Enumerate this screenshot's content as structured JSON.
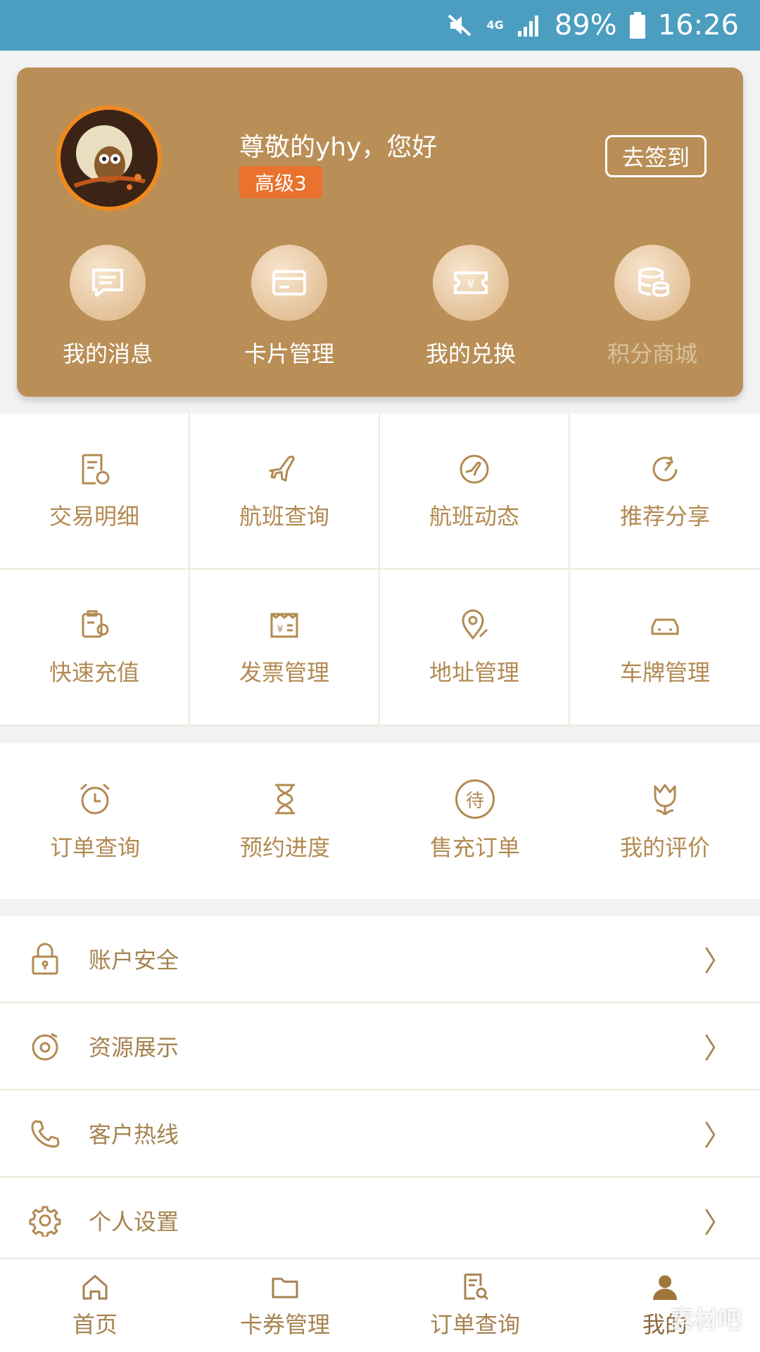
{
  "status_bar": {
    "battery": "89%",
    "time": "16:26",
    "network": "4G"
  },
  "profile": {
    "greeting": "尊敬的yhy，您好",
    "level": "高级3",
    "signin_label": "去签到"
  },
  "quick_actions": [
    {
      "label": "我的消息",
      "icon": "message-icon"
    },
    {
      "label": "卡片管理",
      "icon": "card-icon"
    },
    {
      "label": "我的兑换",
      "icon": "ticket-icon"
    },
    {
      "label": "积分商城",
      "icon": "coins-icon"
    }
  ],
  "grid1": [
    {
      "label": "交易明细",
      "icon": "receipt-icon"
    },
    {
      "label": "航班查询",
      "icon": "plane-icon"
    },
    {
      "label": "航班动态",
      "icon": "flight-status-icon"
    },
    {
      "label": "推荐分享",
      "icon": "share-icon"
    },
    {
      "label": "快速充值",
      "icon": "recharge-icon"
    },
    {
      "label": "发票管理",
      "icon": "invoice-icon"
    },
    {
      "label": "地址管理",
      "icon": "location-icon"
    },
    {
      "label": "车牌管理",
      "icon": "car-icon"
    }
  ],
  "grid2": [
    {
      "label": "订单查询",
      "icon": "clock-icon"
    },
    {
      "label": "预约进度",
      "icon": "hourglass-icon"
    },
    {
      "label": "售充订单",
      "icon": "pending-icon",
      "glyph": "待"
    },
    {
      "label": "我的评价",
      "icon": "tulip-icon"
    }
  ],
  "list": [
    {
      "label": "账户安全",
      "icon": "lock-icon"
    },
    {
      "label": "资源展示",
      "icon": "disc-icon"
    },
    {
      "label": "客户热线",
      "icon": "phone-icon"
    },
    {
      "label": "个人设置",
      "icon": "gear-icon"
    }
  ],
  "bottom_nav": [
    {
      "label": "首页",
      "icon": "home-icon"
    },
    {
      "label": "卡券管理",
      "icon": "folder-icon"
    },
    {
      "label": "订单查询",
      "icon": "order-search-icon"
    },
    {
      "label": "我的",
      "icon": "user-icon",
      "active": true
    }
  ],
  "watermark": "素材吧",
  "colors": {
    "accent": "#b98f57",
    "text_gold": "#b38a52",
    "status_bar": "#4b9ec0",
    "level_badge": "#e8722e"
  }
}
